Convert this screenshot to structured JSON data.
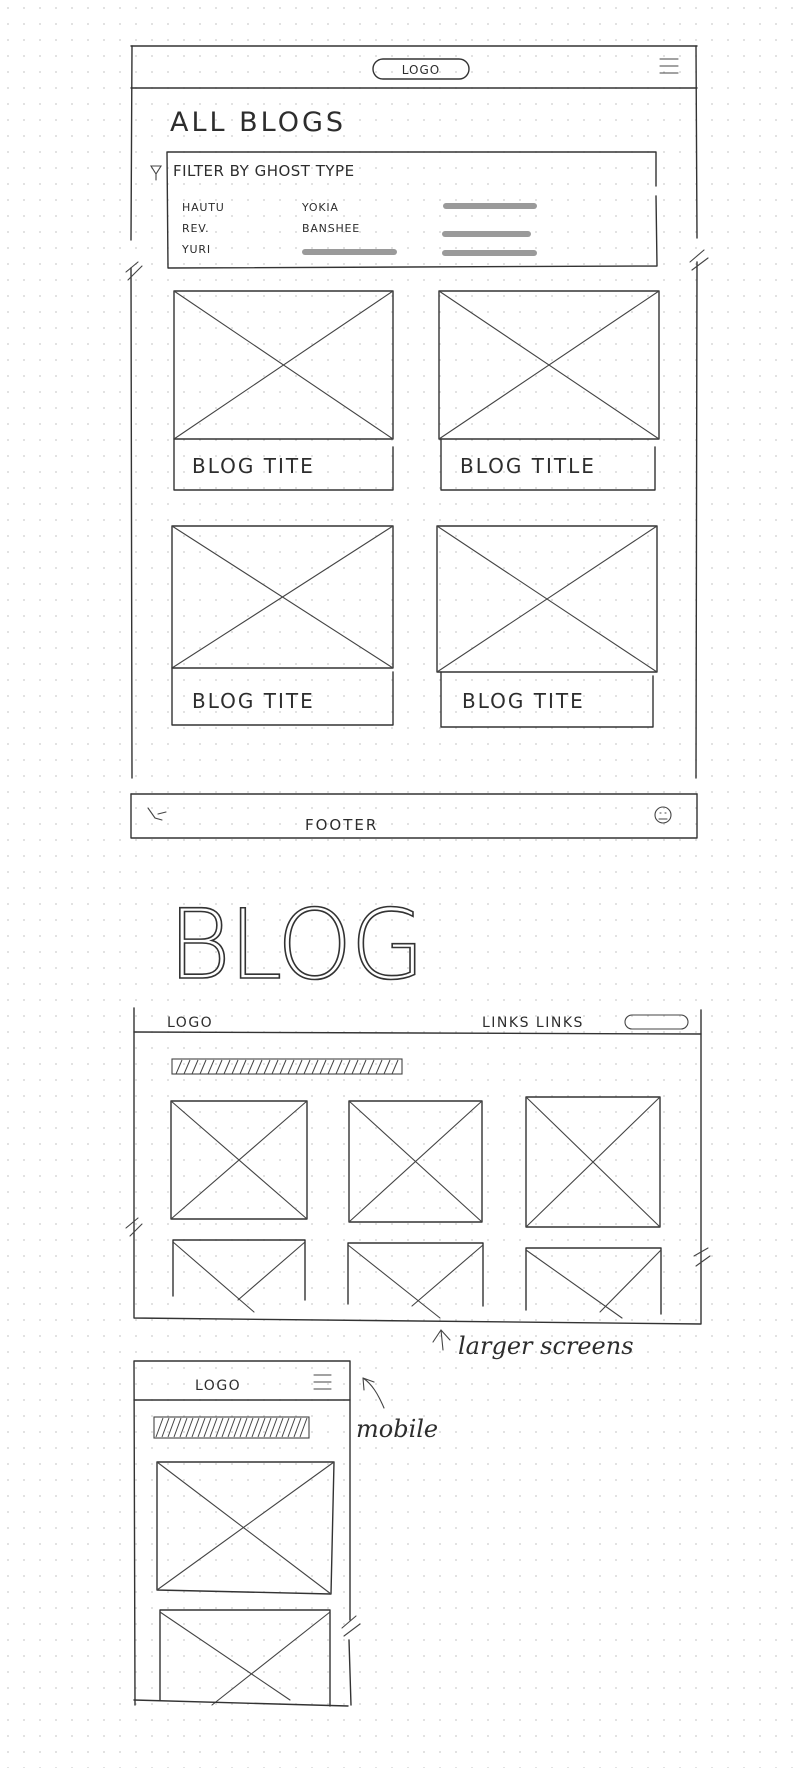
{
  "mobile_listing": {
    "header": {
      "logo": "LOGO"
    },
    "page_heading": "ALL BLOGS",
    "filter": {
      "label": "FILTER BY GHOST TYPE",
      "options": [
        "HAUTU",
        "REV.",
        "YURI",
        "YOKIA",
        "BANSHEE"
      ]
    },
    "cards": [
      {
        "title": "BLOG TITE"
      },
      {
        "title": "BLOG TITLE"
      },
      {
        "title": "BLOG TITE"
      },
      {
        "title": "BLOG TITE"
      }
    ],
    "footer": {
      "label": "FOOTER"
    }
  },
  "blog_section": {
    "heading": "BLOG",
    "desktop": {
      "logo": "LOGO",
      "nav_links": "LINKS LINKS",
      "annotation": "larger screens"
    },
    "mobile": {
      "logo": "LOGO",
      "annotation": "mobile"
    }
  }
}
